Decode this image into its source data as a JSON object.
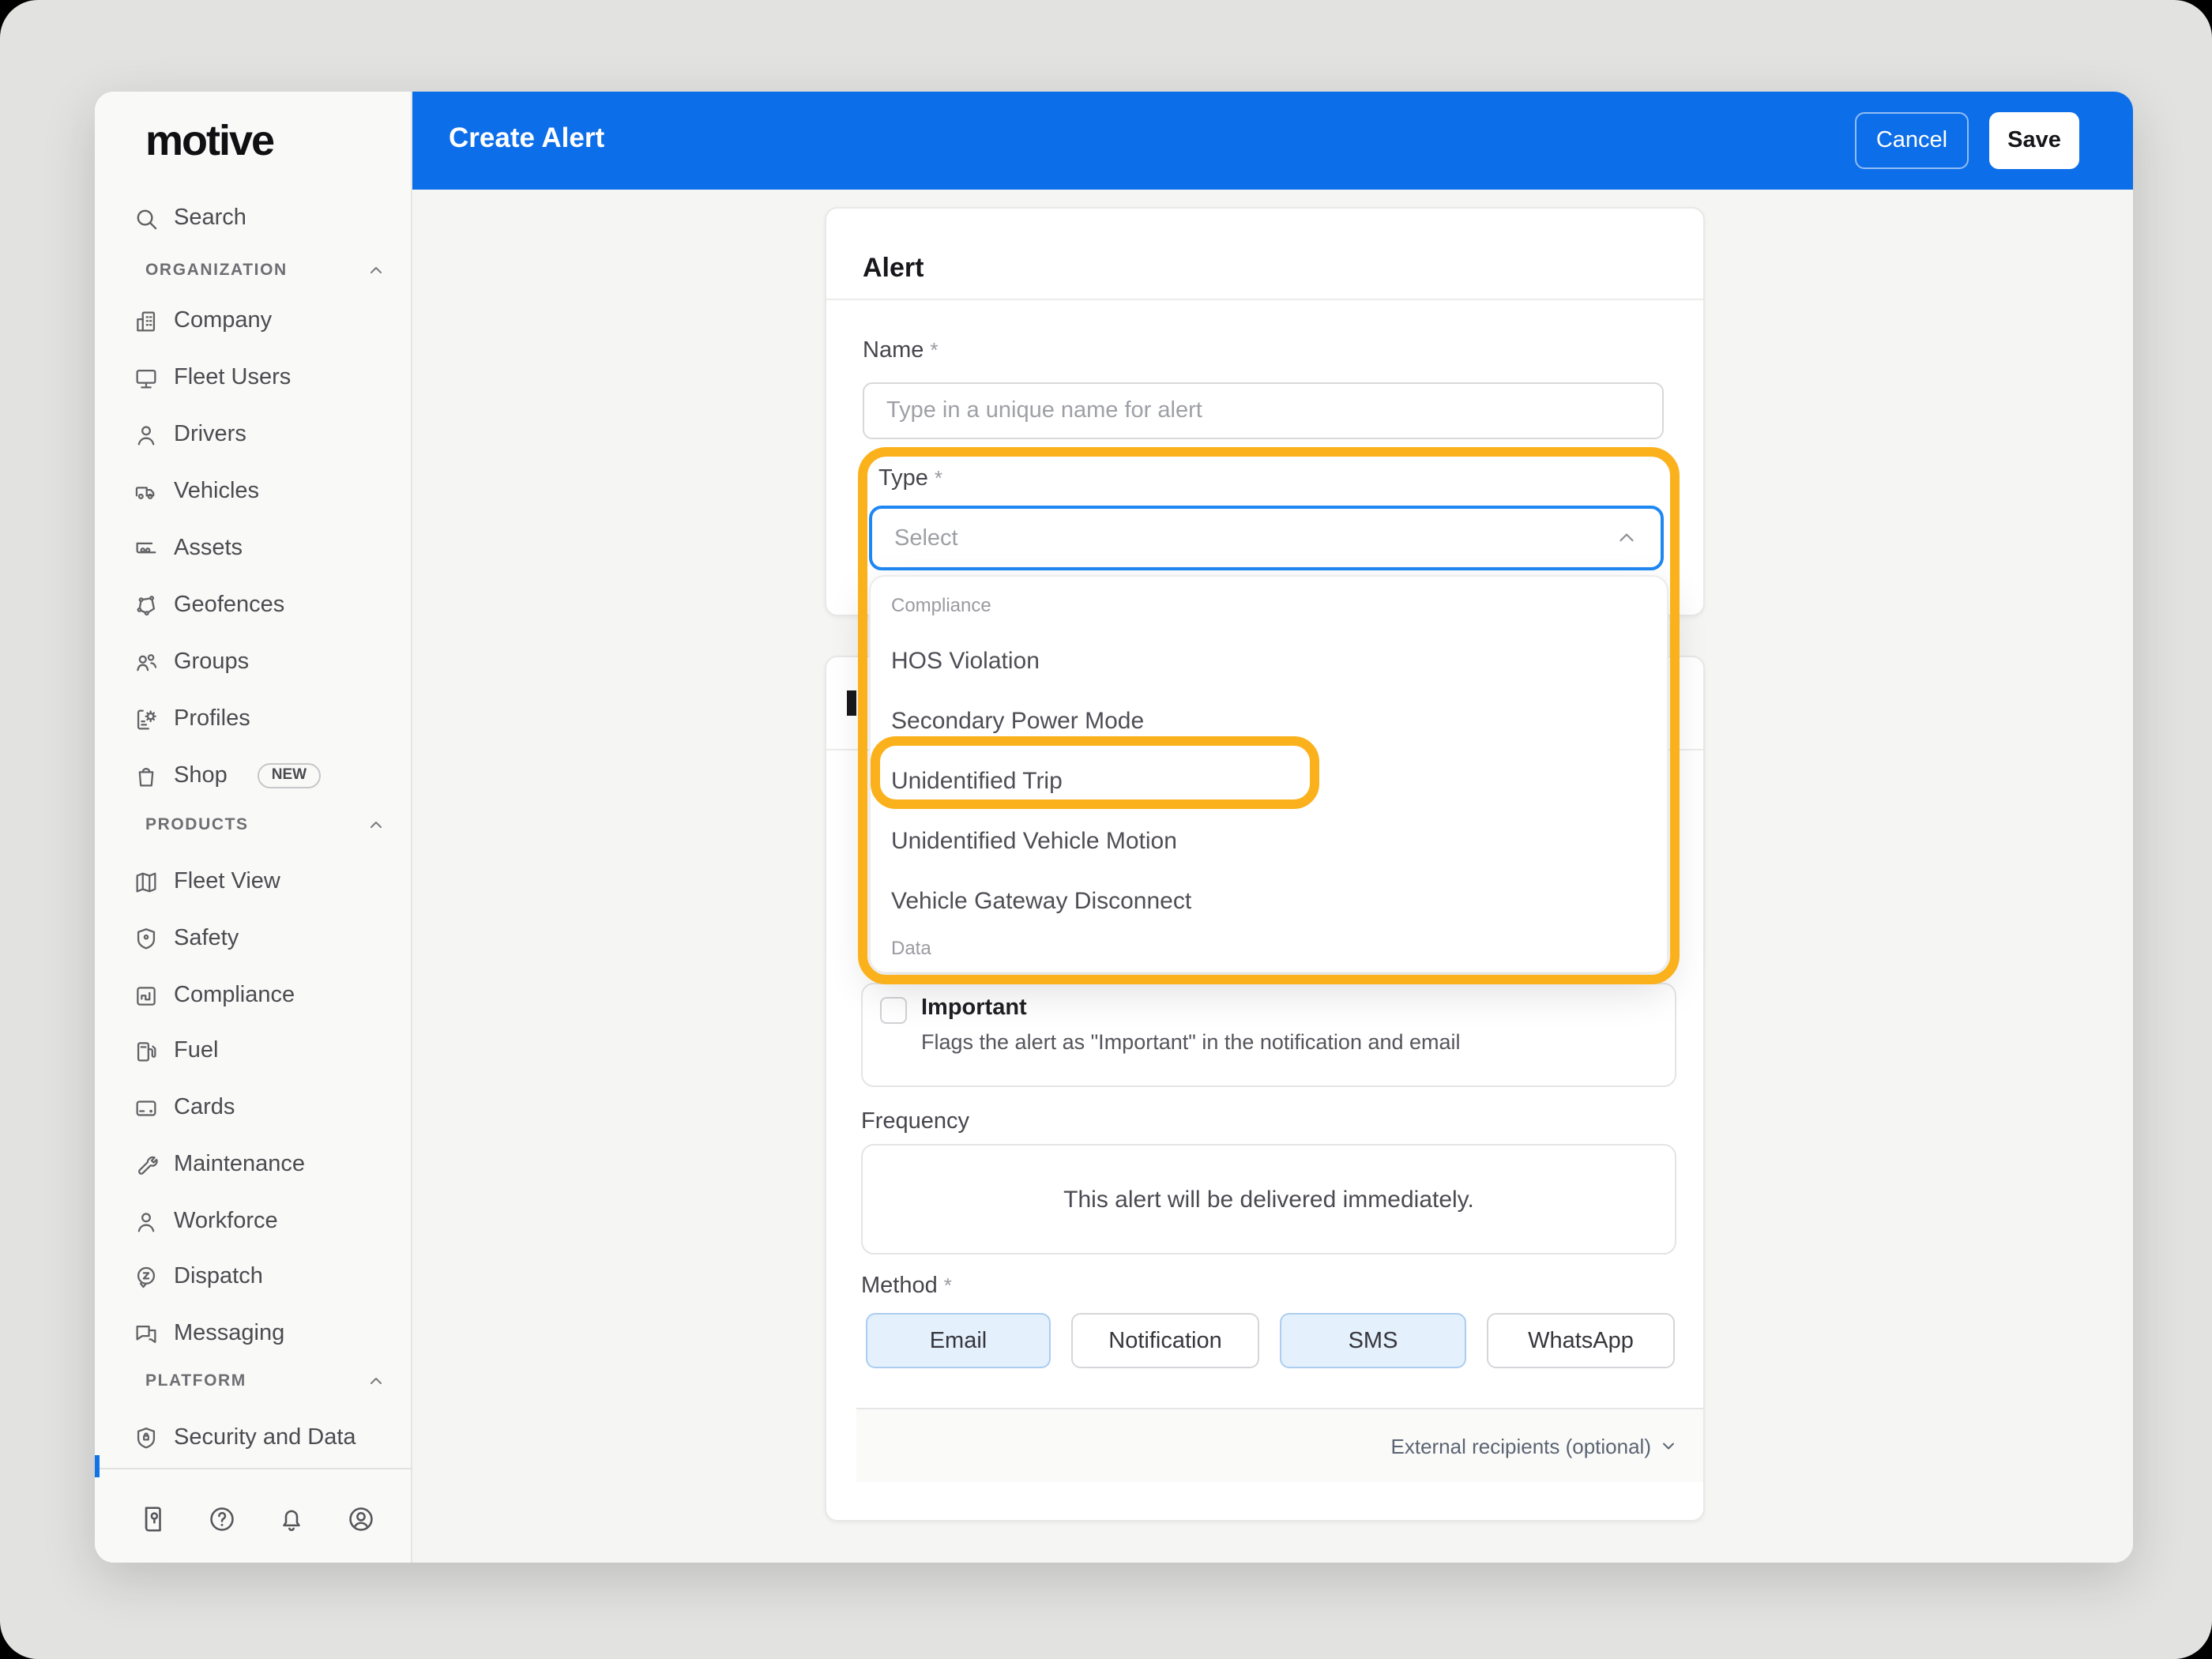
{
  "colors": {
    "header_blue": "#0D6EE9",
    "select_focus_blue": "#1E88F2",
    "annotation_orange": "#FBB11B",
    "method_selected_bg": "#E4F0FC",
    "sidebar_bg": "#F9F9F8",
    "page_bg": "#E2E2E1"
  },
  "header": {
    "title": "Create Alert",
    "cancel_label": "Cancel",
    "save_label": "Save"
  },
  "sidebar": {
    "logo": "motive",
    "search_label": "Search",
    "sections": [
      {
        "header": "ORGANIZATION",
        "items": [
          {
            "label": "Company"
          },
          {
            "label": "Fleet Users"
          },
          {
            "label": "Drivers"
          },
          {
            "label": "Vehicles"
          },
          {
            "label": "Assets"
          },
          {
            "label": "Geofences"
          },
          {
            "label": "Groups"
          },
          {
            "label": "Profiles"
          },
          {
            "label": "Shop",
            "badge": "NEW"
          }
        ]
      },
      {
        "header": "PRODUCTS",
        "items": [
          {
            "label": "Fleet View"
          },
          {
            "label": "Safety"
          },
          {
            "label": "Compliance"
          },
          {
            "label": "Fuel"
          },
          {
            "label": "Cards"
          },
          {
            "label": "Maintenance"
          },
          {
            "label": "Workforce"
          },
          {
            "label": "Dispatch"
          },
          {
            "label": "Messaging"
          }
        ]
      },
      {
        "header": "PLATFORM",
        "items": [
          {
            "label": "Security and Data"
          }
        ]
      }
    ]
  },
  "alert_card": {
    "title": "Alert",
    "name_label": "Name",
    "required_mark": "*",
    "name_placeholder": "Type in a unique name for alert",
    "type_label": "Type",
    "select_placeholder": "Select"
  },
  "type_dropdown": {
    "group1_label": "Compliance",
    "items": [
      "HOS Violation",
      "Secondary Power Mode",
      "Unidentified Trip",
      "Unidentified Vehicle Motion",
      "Vehicle Gateway Disconnect"
    ],
    "group2_label": "Data",
    "highlighted_item": "Unidentified Trip"
  },
  "recipients_card": {
    "important_label": "Important",
    "important_description": "Flags the alert as \"Important\" in the notification and email",
    "frequency_label": "Frequency",
    "frequency_text": "This alert will be delivered immediately.",
    "method_label": "Method",
    "method_required_mark": "*",
    "methods": [
      {
        "label": "Email",
        "selected": true
      },
      {
        "label": "Notification",
        "selected": false
      },
      {
        "label": "SMS",
        "selected": true
      },
      {
        "label": "WhatsApp",
        "selected": false
      }
    ],
    "external_recipients_label": "External recipients (optional)"
  }
}
